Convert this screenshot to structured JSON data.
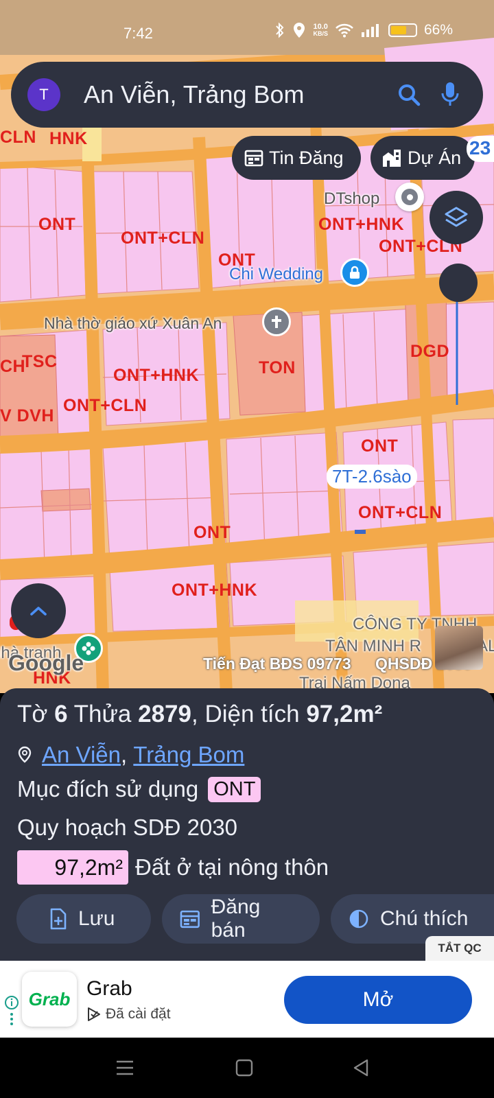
{
  "status_bar": {
    "time": "7:42",
    "net_speed_value": "10.0",
    "net_speed_unit": "KB/S",
    "battery": "66%",
    "battery_level": 0.66
  },
  "search": {
    "avatar_letter": "T",
    "query": "An Viễn, Trảng Bom"
  },
  "chips": {
    "news": "Tin Đăng",
    "projects": "Dự Án",
    "partial_number": "23"
  },
  "map": {
    "zone_labels": [
      "CLN",
      "HNK",
      "ONT",
      "ONT+CLN",
      "ONT",
      "ONT+HNK",
      "ONT+CLN",
      "CH",
      "TSC",
      "ONT+HNK",
      "TON",
      "DGD",
      "V DVH",
      "ONT+CLN",
      "ONT",
      "ONT+CLN",
      "ONT",
      "ONT+HNK",
      "HNK"
    ],
    "pois": {
      "dtshop": "DTshop",
      "wedding": "Chi Wedding",
      "church": "Nhà thờ giáo xứ Xuân An",
      "company_line1": "CÔNG TY TNHH",
      "company_line2": "TÂN MINH R",
      "company_line2_tail": "AL",
      "mushroom": "Trại Nấm Dona",
      "left_cut": "nhà tranh"
    },
    "lot_tag": "7T-2.6sào",
    "watermark": "Tiến Đạt BĐS 09773",
    "plan_label": "QHSDĐ 2030",
    "google_logo": "Google"
  },
  "sheet": {
    "to_label": "Tờ",
    "to_value": "6",
    "thua_label": "Thửa",
    "thua_value": "2879",
    "area_label": "Diện tích",
    "area_value": "97,2m²",
    "location_commune": "An Viễn",
    "location_district": "Trảng Bom",
    "purpose_label": "Mục đích sử dụng",
    "purpose_code": "ONT",
    "plan": "Quy hoạch SDĐ 2030",
    "land_area": "97,2m²",
    "land_type": "Đất ở tại nông thôn",
    "buttons": {
      "save": "Lưu",
      "sell": "Đăng bán",
      "legend": "Chú thích"
    },
    "hide_ads": "TẮT QC"
  },
  "ad": {
    "logo_text": "Grab",
    "name": "Grab",
    "installed": "Đã cài đặt",
    "open": "Mở"
  },
  "colors": {
    "panel": "#2e3240",
    "land_residential": "#f8c8f2",
    "road": "#f3a94a",
    "zone_text": "#e0201c",
    "primary_button": "#1254c7"
  }
}
